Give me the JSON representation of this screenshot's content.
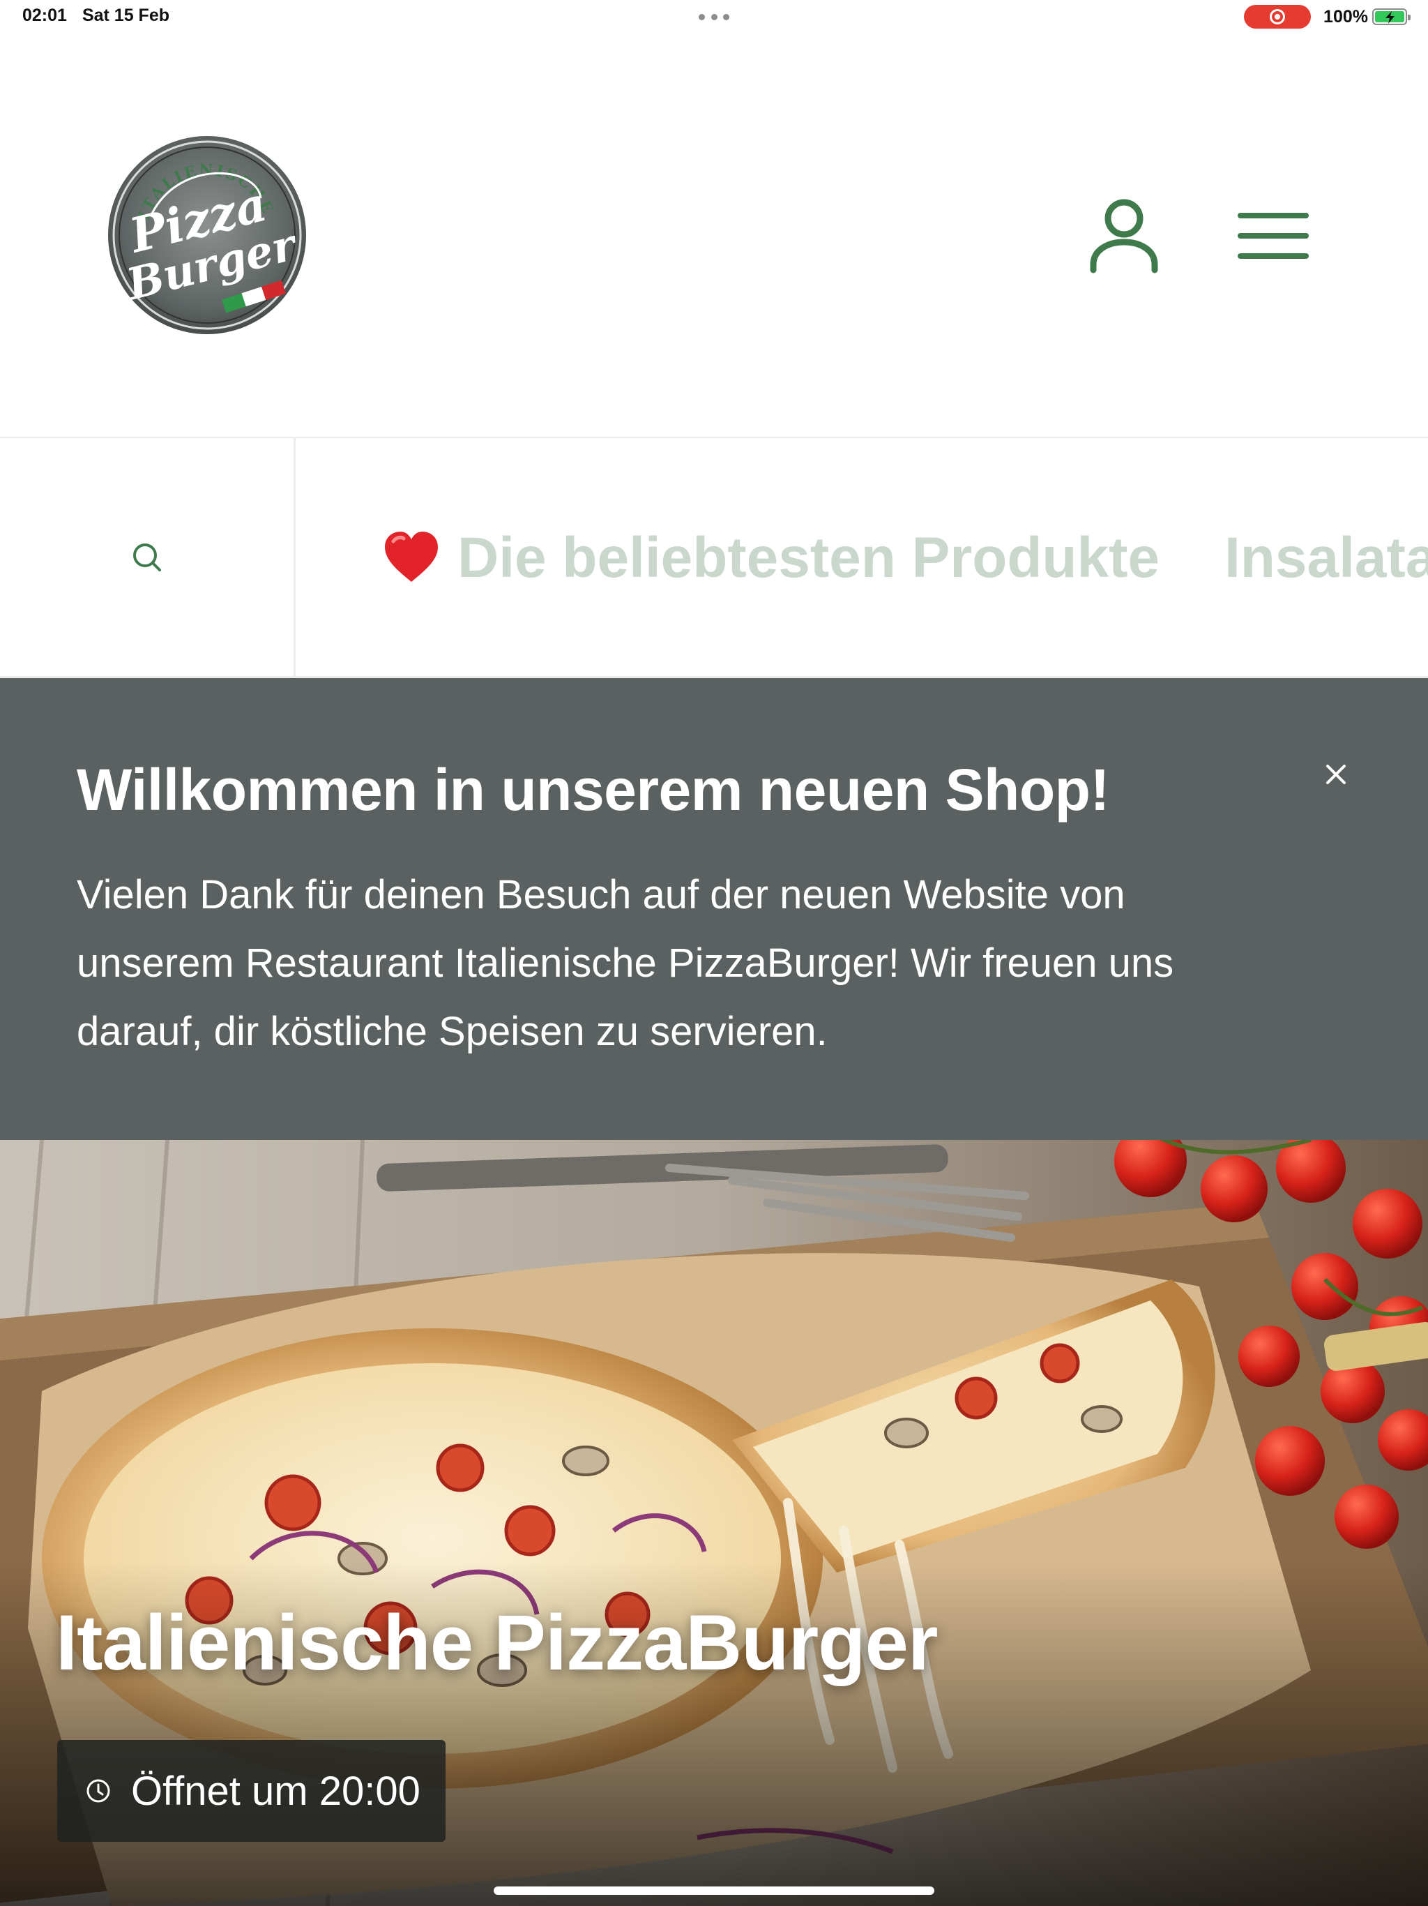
{
  "status_bar": {
    "time": "02:01",
    "date": "Sat 15 Feb",
    "battery_percent": "100%",
    "battery_level": 1.0,
    "recording_color": "#e53a2f"
  },
  "header": {
    "logo_name": "PizzaBurger logo",
    "logo_lettering": [
      "ITALIENISCHE",
      "Pizza",
      "Burger"
    ],
    "account_icon": "user-icon",
    "menu_icon": "hamburger-menu-icon",
    "accent_color": "#3f7a4c"
  },
  "category_nav": {
    "search_icon": "search-icon",
    "items": [
      {
        "emoji": "heart-icon",
        "label": "Die beliebtesten Produkte"
      },
      {
        "label": "Insalata"
      }
    ],
    "inactive_color": "#c9d7cc"
  },
  "welcome_banner": {
    "title": "Willkommen in unserem neuen Shop!",
    "body_lines": [
      "Vielen Dank für deinen Besuch auf der neuen Website von",
      "unserem Restaurant Italienische PizzaBurger! Wir freuen uns",
      "darauf, dir köstliche Speisen zu servieren."
    ],
    "close_icon": "close-icon",
    "background": "#5a6160"
  },
  "hero": {
    "title": "Italienische PizzaBurger",
    "opening_status": "Öffnet um 20:00",
    "clock_icon": "clock-icon"
  }
}
